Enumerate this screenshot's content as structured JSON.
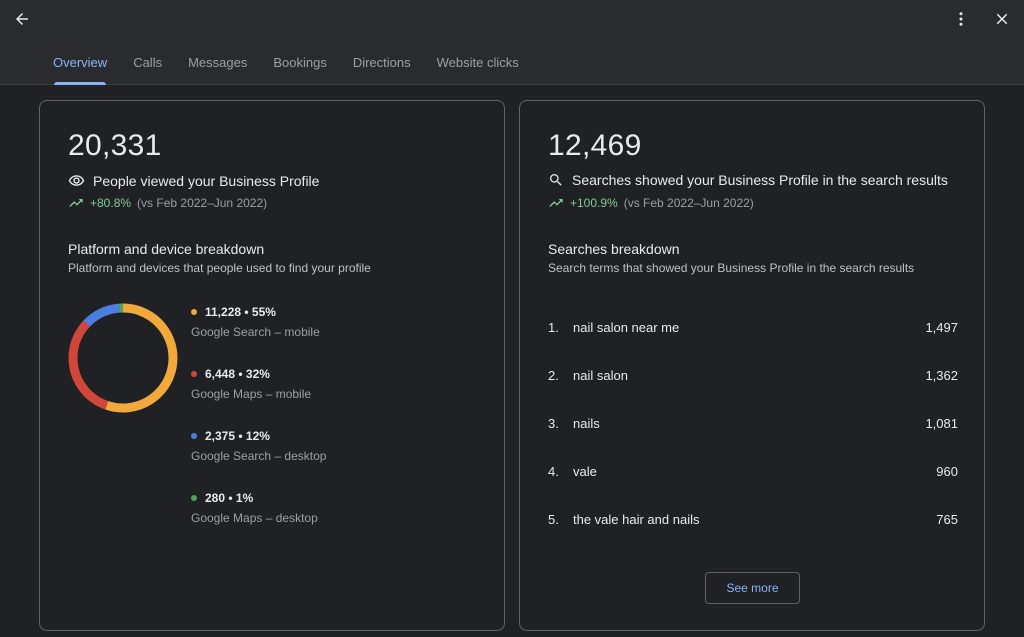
{
  "tabs": [
    "Overview",
    "Calls",
    "Messages",
    "Bookings",
    "Directions",
    "Website clicks"
  ],
  "views": {
    "total": "20,331",
    "description": "People viewed your Business Profile",
    "change": "+80.8%",
    "comparison": "(vs Feb 2022–Jun 2022)"
  },
  "platform": {
    "title": "Platform and device breakdown",
    "subtitle": "Platform and devices that people used to find your profile",
    "items": [
      {
        "stat": "11,228 • 55%",
        "label": "Google Search – mobile",
        "value": 11228,
        "color": "#f2a93b"
      },
      {
        "stat": "6,448 • 32%",
        "label": "Google Maps – mobile",
        "value": 6448,
        "color": "#d0463b"
      },
      {
        "stat": "2,375 • 12%",
        "label": "Google Search – desktop",
        "value": 2375,
        "color": "#4a7fe0"
      },
      {
        "stat": "280 • 1%",
        "label": "Google Maps – desktop",
        "value": 280,
        "color": "#4ea55a"
      }
    ]
  },
  "searches": {
    "total": "12,469",
    "description": "Searches showed your Business Profile in the search results",
    "change": "+100.9%",
    "comparison": "(vs Feb 2022–Jun 2022)",
    "title": "Searches breakdown",
    "subtitle": "Search terms that showed your Business Profile in the search results",
    "items": [
      {
        "index": "1.",
        "term": "nail salon near me",
        "count": "1,497"
      },
      {
        "index": "2.",
        "term": "nail salon",
        "count": "1,362"
      },
      {
        "index": "3.",
        "term": "nails",
        "count": "1,081"
      },
      {
        "index": "4.",
        "term": "vale",
        "count": "960"
      },
      {
        "index": "5.",
        "term": "the vale hair and nails",
        "count": "765"
      }
    ],
    "see_more": "See more"
  },
  "colors": {
    "accent": "#8ab4f8",
    "positive": "#81c995"
  },
  "icons": {
    "back": "arrow-back-icon",
    "more": "more-vert-icon",
    "close": "close-icon",
    "views": "eye-icon",
    "search": "search-icon",
    "trend": "trending-up-icon"
  }
}
